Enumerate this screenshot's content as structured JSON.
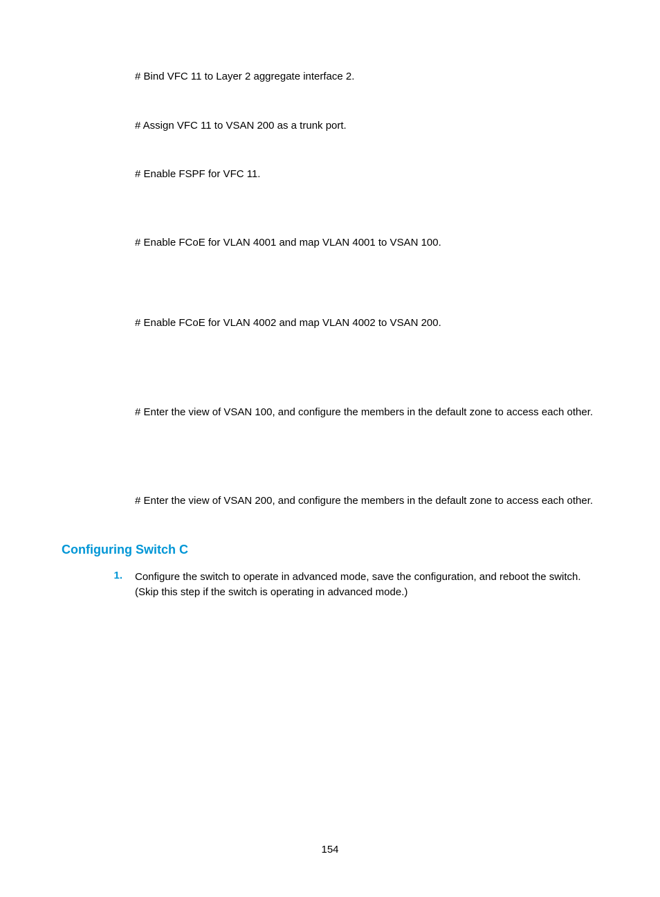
{
  "steps": {
    "bind_vfc11": "# Bind VFC 11 to Layer 2 aggregate interface 2.",
    "assign_vfc11": "# Assign VFC 11 to VSAN 200 as a trunk port.",
    "enable_fspf": "# Enable FSPF for VFC 11.",
    "enable_fcoe_4001": "# Enable FCoE for VLAN 4001 and map VLAN 4001 to VSAN 100.",
    "enable_fcoe_4002": "# Enable FCoE for VLAN 4002 and map VLAN 4002 to VSAN 200.",
    "enter_vsan100": "# Enter the view of VSAN 100, and configure the members in the default zone to access each other.",
    "enter_vsan200": "# Enter the view of VSAN 200, and configure the members in the default zone to access each other."
  },
  "section": {
    "heading": "Configuring Switch C",
    "item1_number": "1.",
    "item1_text": "Configure the switch to operate in advanced mode, save the configuration, and reboot the switch. (Skip this step if the switch is operating in advanced mode.)"
  },
  "page_number": "154"
}
